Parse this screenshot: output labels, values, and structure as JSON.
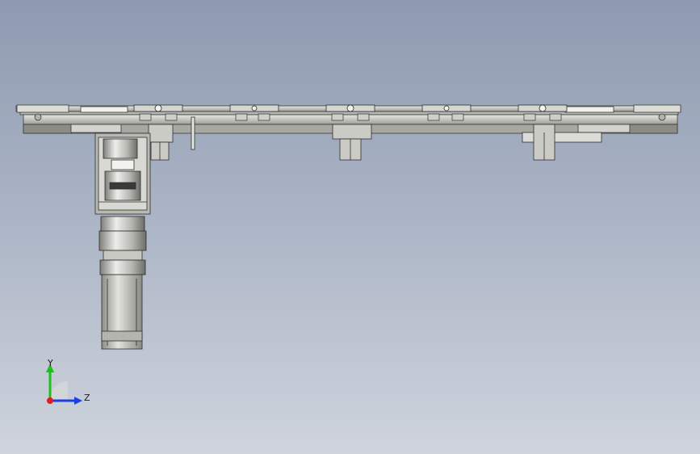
{
  "viewport": {
    "background_top": "#8e9ab0",
    "background_bottom": "#cfd4dd"
  },
  "model": {
    "description_icon": "assembly-icon",
    "part_color": "#c9c9c4",
    "edge_color": "#3a3a3a"
  },
  "triad": {
    "y_label": "Y",
    "z_label": "Z",
    "y_color": "#1cbf1c",
    "z_color": "#1c3fe0",
    "x_color": "#e01c1c"
  }
}
